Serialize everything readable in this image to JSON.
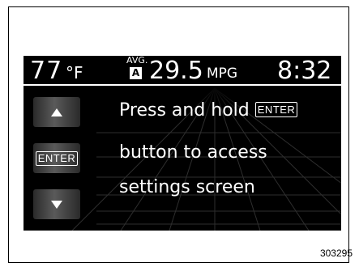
{
  "status_bar": {
    "temperature": "77",
    "temperature_unit": "°F",
    "avg_label": "AVG.",
    "trip_badge": "A",
    "fuel_economy": "29.5",
    "fuel_economy_unit": "MPG",
    "clock": "8:32"
  },
  "side_buttons": {
    "up_icon": "triangle-up-icon",
    "enter_label": "ENTER",
    "down_icon": "triangle-down-icon"
  },
  "message": {
    "line1_text": "Press and hold",
    "line1_key": "ENTER",
    "line2": "button to access",
    "line3": "settings screen"
  },
  "figure_id": "303295"
}
